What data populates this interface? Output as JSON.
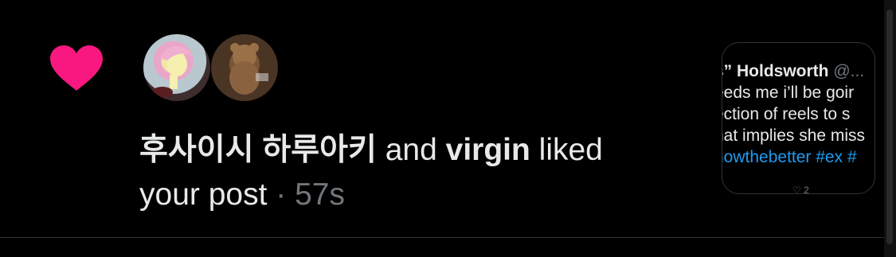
{
  "notification": {
    "type_icon": "heart-icon",
    "accent_color": "#f91880",
    "avatars": [
      {
        "description_icon": "avatar-pony"
      },
      {
        "description_icon": "avatar-teddy-bear"
      }
    ],
    "user1": "후사이시 하루아키",
    "conjunction": " and ",
    "user2": "virgin",
    "action": " liked your post",
    "separator": " · ",
    "time": "57s"
  },
  "preview": {
    "author": "s” Holdsworth",
    "handle": "@...",
    "lines": [
      "eeds me i’ll be goir",
      "ection of reels to s",
      "hat implies she miss"
    ],
    "hashtags": "nowthebetter #ex #",
    "reply_count": "2"
  }
}
